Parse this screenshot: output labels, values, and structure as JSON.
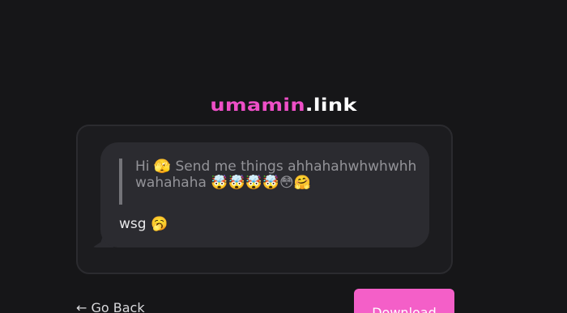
{
  "header": {
    "brand": "umamin",
    "tld": ".link"
  },
  "message": {
    "quote": "Hi 🫣 Send me things ahhahahwhwhwhhwahahaha 🤯🤯🤯🤯😳🤗",
    "reply": "wsg 🥱"
  },
  "actions": {
    "back_label": "← Go Back",
    "download_label": "Download"
  },
  "colors": {
    "accent": "#f45fc8",
    "background": "#161618",
    "card": "#1c1c1f",
    "bubble": "#2b2b30"
  }
}
